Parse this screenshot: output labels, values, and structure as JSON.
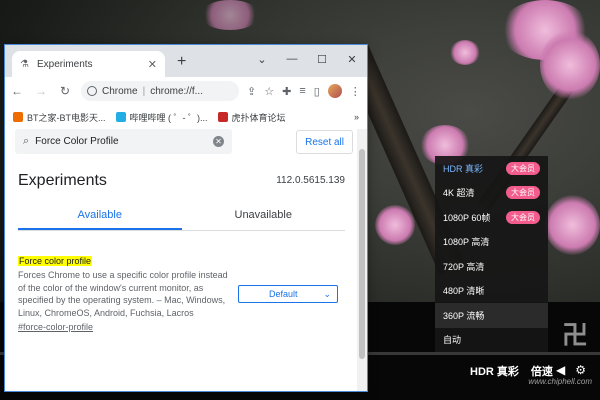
{
  "browser": {
    "tab_title": "Experiments",
    "omnibox": {
      "host_label": "Chrome",
      "url_text": "chrome://f..."
    },
    "bookmarks": [
      {
        "label": "BT之家-BT电影天...",
        "color": "#ef6c00"
      },
      {
        "label": "哔哩哔哩 ( ゜- ゜)...",
        "color": "#23ade5"
      },
      {
        "label": "虎扑体育论坛",
        "color": "#c62828"
      }
    ]
  },
  "experiments": {
    "search_value": "Force Color Profile",
    "reset_label": "Reset all",
    "title": "Experiments",
    "version": "112.0.5615.139",
    "tabs": {
      "available": "Available",
      "unavailable": "Unavailable"
    },
    "flag": {
      "name": "Force color profile",
      "description": "Forces Chrome to use a specific color profile instead of the color of the window's current monitor, as specified by the operating system. – Mac, Windows, Linux, ChromeOS, Android, Fuchsia, Lacros",
      "link": "#force-color-profile",
      "selected": "Default"
    }
  },
  "player": {
    "quality_menu": [
      {
        "label": "HDR 真彩",
        "badge": "大会员",
        "state": "active"
      },
      {
        "label": "4K 超清",
        "badge": "大会员",
        "state": ""
      },
      {
        "label": "1080P 60帧",
        "badge": "大会员",
        "state": ""
      },
      {
        "label": "1080P 高清",
        "badge": "",
        "state": ""
      },
      {
        "label": "720P 高清",
        "badge": "",
        "state": ""
      },
      {
        "label": "480P 清晰",
        "badge": "",
        "state": ""
      },
      {
        "label": "360P 流畅",
        "badge": "",
        "state": "selected"
      },
      {
        "label": "自动",
        "badge": "",
        "state": ""
      }
    ],
    "quality_button": "HDR 真彩",
    "speed_button": "倍速",
    "watermark": "chiphell",
    "site_url": "www.chiphell.com"
  },
  "colors": {
    "accent": "#1a73e8",
    "vip_badge": "#f25d8e",
    "active_quality": "#7ab8ff",
    "highlight": "#ffff00"
  }
}
